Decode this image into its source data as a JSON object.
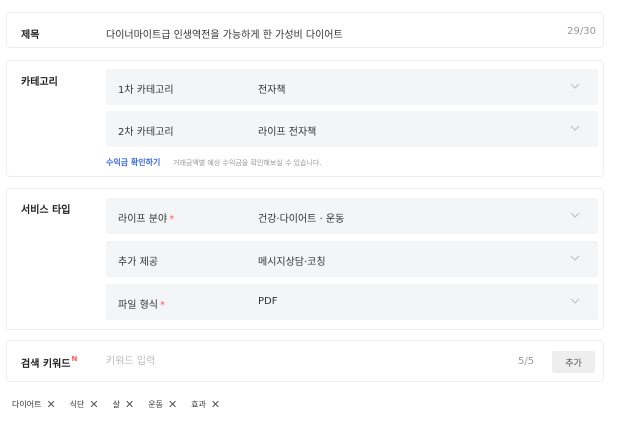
{
  "title": {
    "label": "제목",
    "value": "다이너마이트급 인생역전을 가능하게 한 가성비 다이어트",
    "count": "29/30"
  },
  "category": {
    "label": "카테고리",
    "rows": [
      {
        "label": "1차 카테고리",
        "value": "전자책"
      },
      {
        "label": "2차 카테고리",
        "value": "라이프 전자책"
      }
    ],
    "help_link": "수익금 확인하기",
    "help_text": "거래금액별 예상 수익금을 확인해보실 수 있습니다."
  },
  "service": {
    "label": "서비스 타입",
    "rows": [
      {
        "label": "라이프 분야",
        "required_mark": "*",
        "value": "건강·다이어트 · 운동"
      },
      {
        "label": "추가 제공",
        "required_mark": "",
        "value": "메시지상담·코칭"
      },
      {
        "label": "파일 형식",
        "required_mark": "*",
        "value": "PDF"
      }
    ]
  },
  "keyword": {
    "label": "검색 키워드",
    "new_badge": "N",
    "placeholder": "키워드 입력",
    "count": "5/5",
    "add_label": "추가"
  },
  "tags": [
    "다이어트",
    "식단",
    "살",
    "운동",
    "효과"
  ],
  "colors": {
    "accent_link": "#3d6bd8",
    "required": "#ff5a5a",
    "row_background": "#f4f5f7"
  }
}
